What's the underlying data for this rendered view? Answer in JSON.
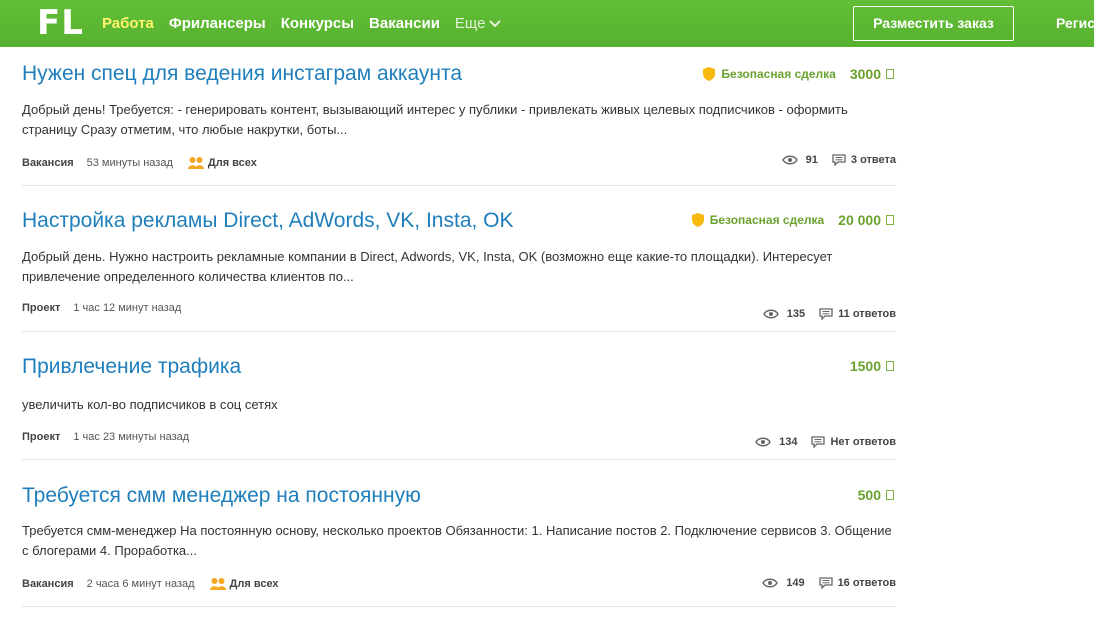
{
  "header": {
    "logo": "FL",
    "nav": [
      "Работа",
      "Фрилансеры",
      "Конкурсы",
      "Вакансии",
      "Еще"
    ],
    "post_button": "Разместить заказ",
    "register": "Регистрация"
  },
  "colors": {
    "header_green": "#5cb833",
    "link_blue": "#1f7fbc",
    "price_green": "#6aa22f",
    "active_nav": "#fff56b",
    "shield": "#f5b90f"
  },
  "projects": [
    {
      "title": "Нужен спец для ведения инстаграм аккаунта",
      "safe_deal": "Безопасная сделка",
      "price": "3000",
      "description": "Добрый день! Требуется: - генерировать контент, вызывающий интерес у публики - привлекать живых целевых подписчиков - оформить страницу Сразу отметим, что любые накрутки, боты...",
      "type": "Вакансия",
      "time": "53 минуты назад",
      "audience": "Для всех",
      "views": "91",
      "answers": "3 ответа"
    },
    {
      "title": "Настройка рекламы Direct, AdWords, VK, Insta, OK",
      "safe_deal": "Безопасная сделка",
      "price": "20 000",
      "description": "Добрый день. Нужно настроить рекламные компании в Direct, Adwords, VK, Insta, OK (возможно еще какие-то площадки). Интересует привлечение определенного количества клиентов по...",
      "type": "Проект",
      "time": "1 час 12 минут назад",
      "views": "135",
      "answers": "11 ответов"
    },
    {
      "title": "Привлечение трафика",
      "price": "1500",
      "description": "увеличить кол-во подписчиков в соц сетях",
      "type": "Проект",
      "time": "1 час 23 минуты назад",
      "views": "134",
      "answers": "Нет ответов"
    },
    {
      "title": "Требуется смм менеджер на постоянную",
      "price": "500",
      "description": "Требуется смм-менеджер На постоянную основу, несколько проектов Обязанности: 1. Написание постов 2. Подключение сервисов 3. Общение с блогерами 4. Проработка...",
      "type": "Вакансия",
      "time": "2 часа 6 минут назад",
      "audience": "Для всех",
      "views": "149",
      "answers": "16 ответов"
    }
  ]
}
